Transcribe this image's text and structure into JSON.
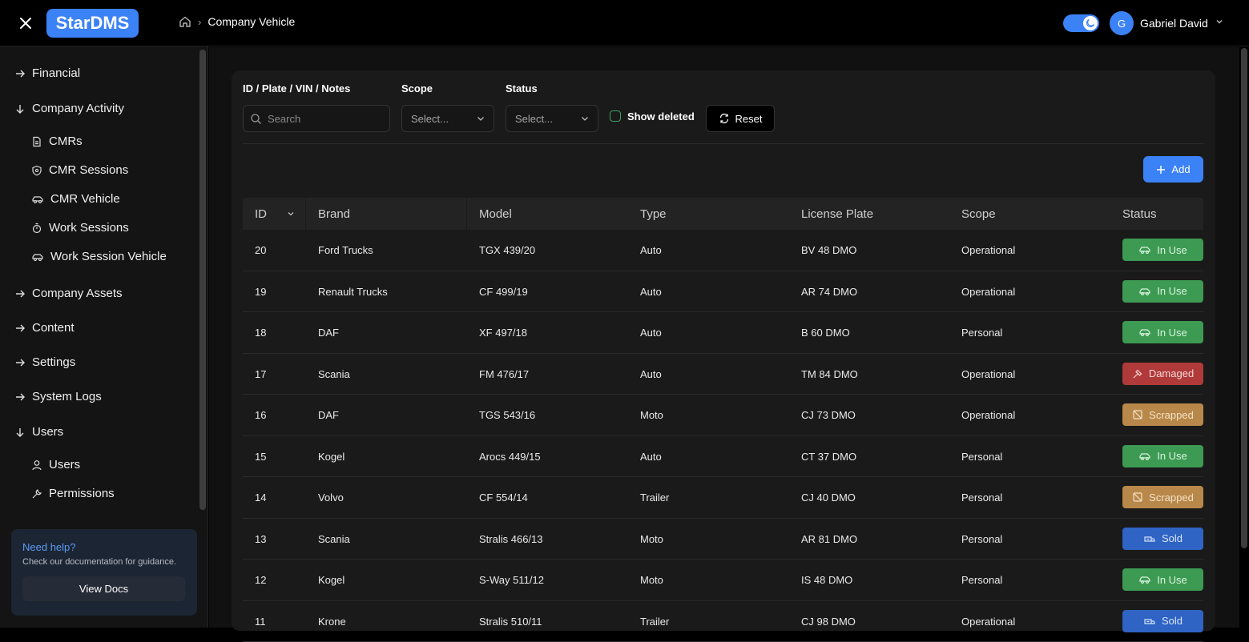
{
  "app": {
    "logo": "StarDMS"
  },
  "breadcrumb": {
    "current": "Company Vehicle"
  },
  "user": {
    "initial": "G",
    "name": "Gabriel David"
  },
  "sidebar": {
    "items": [
      {
        "label": "Financial",
        "expanded": false
      },
      {
        "label": "Company Activity",
        "expanded": true,
        "children": [
          {
            "label": "CMRs",
            "icon": "document-icon"
          },
          {
            "label": "CMR Sessions",
            "icon": "shield-icon"
          },
          {
            "label": "CMR Vehicle",
            "icon": "car-icon"
          },
          {
            "label": "Work Sessions",
            "icon": "timer-icon"
          },
          {
            "label": "Work Session Vehicle",
            "icon": "car-icon"
          }
        ]
      },
      {
        "label": "Company Assets",
        "expanded": false
      },
      {
        "label": "Content",
        "expanded": false
      },
      {
        "label": "Settings",
        "expanded": false
      },
      {
        "label": "System Logs",
        "expanded": false
      },
      {
        "label": "Users",
        "expanded": true,
        "children": [
          {
            "label": "Users",
            "icon": "user-icon"
          },
          {
            "label": "Permissions",
            "icon": "wrench-icon"
          }
        ]
      }
    ]
  },
  "help": {
    "title": "Need help?",
    "subtitle": "Check our documentation for guidance.",
    "button": "View Docs"
  },
  "filters": {
    "search_label": "ID / Plate / VIN / Notes",
    "search_placeholder": "Search",
    "scope_label": "Scope",
    "scope_value": "Select...",
    "status_label": "Status",
    "status_value": "Select...",
    "show_deleted": "Show deleted",
    "reset": "Reset"
  },
  "add_button": "Add",
  "table": {
    "columns": [
      "ID",
      "Brand",
      "Model",
      "Type",
      "License Plate",
      "Scope",
      "Status"
    ],
    "rows": [
      {
        "id": "20",
        "brand": "Ford Trucks",
        "model": "TGX 439/20",
        "type": "Auto",
        "plate": "BV 48 DMO",
        "scope": "Operational",
        "status": "In Use"
      },
      {
        "id": "19",
        "brand": "Renault Trucks",
        "model": "CF 499/19",
        "type": "Auto",
        "plate": "AR 74 DMO",
        "scope": "Operational",
        "status": "In Use"
      },
      {
        "id": "18",
        "brand": "DAF",
        "model": "XF 497/18",
        "type": "Auto",
        "plate": "B 60 DMO",
        "scope": "Personal",
        "status": "In Use"
      },
      {
        "id": "17",
        "brand": "Scania",
        "model": "FM 476/17",
        "type": "Auto",
        "plate": "TM 84 DMO",
        "scope": "Operational",
        "status": "Damaged"
      },
      {
        "id": "16",
        "brand": "DAF",
        "model": "TGS 543/16",
        "type": "Moto",
        "plate": "CJ 73 DMO",
        "scope": "Operational",
        "status": "Scrapped"
      },
      {
        "id": "15",
        "brand": "Kogel",
        "model": "Arocs 449/15",
        "type": "Auto",
        "plate": "CT 37 DMO",
        "scope": "Personal",
        "status": "In Use"
      },
      {
        "id": "14",
        "brand": "Volvo",
        "model": "CF 554/14",
        "type": "Trailer",
        "plate": "CJ 40 DMO",
        "scope": "Personal",
        "status": "Scrapped"
      },
      {
        "id": "13",
        "brand": "Scania",
        "model": "Stralis 466/13",
        "type": "Moto",
        "plate": "AR 81 DMO",
        "scope": "Personal",
        "status": "Sold"
      },
      {
        "id": "12",
        "brand": "Kogel",
        "model": "S-Way 511/12",
        "type": "Moto",
        "plate": "IS 48 DMO",
        "scope": "Personal",
        "status": "In Use"
      },
      {
        "id": "11",
        "brand": "Krone",
        "model": "Stralis 510/11",
        "type": "Trailer",
        "plate": "CJ 98 DMO",
        "scope": "Operational",
        "status": "Sold"
      }
    ]
  },
  "status_styles": {
    "In Use": {
      "bg": "#3d9a52",
      "fg": "#d9f5df",
      "icon": "car-icon"
    },
    "Damaged": {
      "bg": "#b03a3a",
      "fg": "#f7d6d6",
      "icon": "hammer-icon"
    },
    "Scrapped": {
      "bg": "#b8884a",
      "fg": "#f3e2c6",
      "icon": "scrapped-icon"
    },
    "Sold": {
      "bg": "#2f63c4",
      "fg": "#d8e5fb",
      "icon": "sold-icon"
    }
  },
  "colors": {
    "accent": "#3b82f6",
    "background": "#000000",
    "card": "#1a1a1a"
  }
}
